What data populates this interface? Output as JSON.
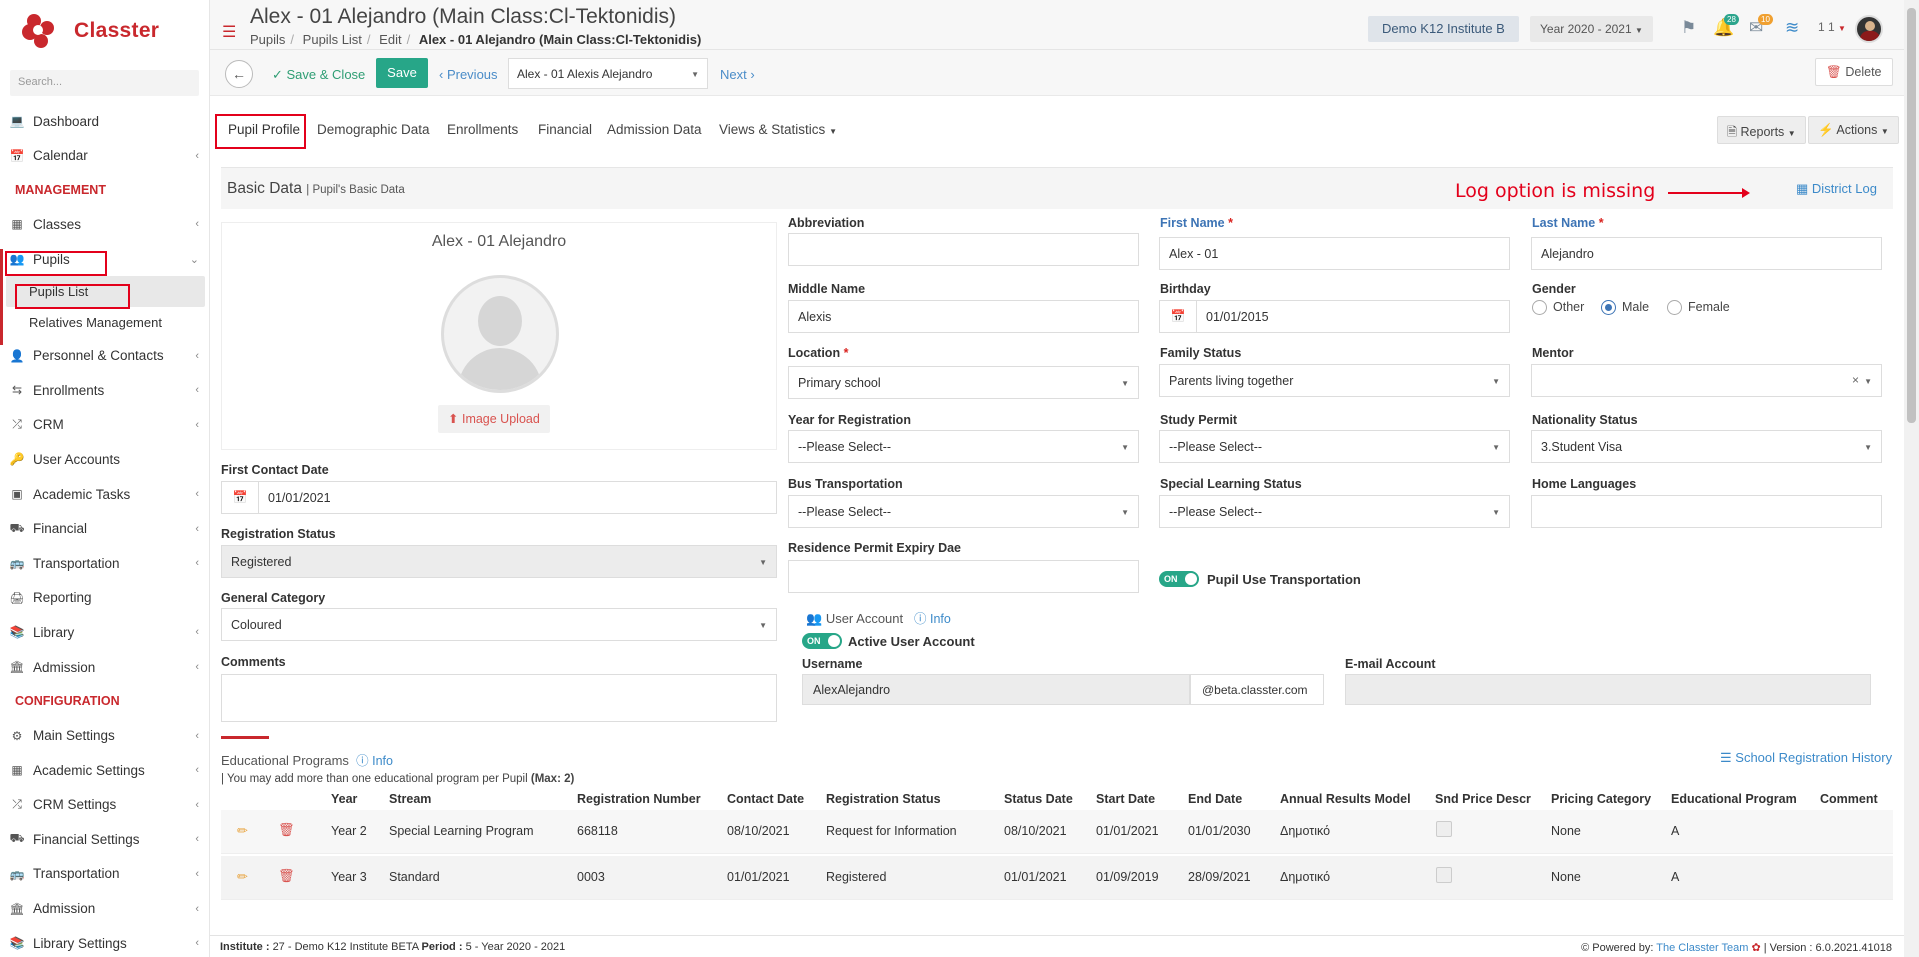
{
  "brand": {
    "name": "Classter"
  },
  "sidebar": {
    "search_placeholder": "Search...",
    "items_top": [
      {
        "label": "Dashboard",
        "icon": "laptop-icon"
      },
      {
        "label": "Calendar",
        "icon": "calendar-icon"
      }
    ],
    "section_management": "MANAGEMENT",
    "items_management": [
      {
        "label": "Classes",
        "icon": "classes-icon"
      },
      {
        "label": "Pupils",
        "icon": "users-icon"
      }
    ],
    "pupils_sub": [
      "Pupils List",
      "Relatives Management"
    ],
    "items_more": [
      {
        "label": "Personnel & Contacts",
        "icon": "person-icon"
      },
      {
        "label": "Enrollments",
        "icon": "exchange-icon"
      },
      {
        "label": "CRM",
        "icon": "random-icon"
      },
      {
        "label": "User Accounts",
        "icon": "key-icon"
      },
      {
        "label": "Academic Tasks",
        "icon": "grid-icon"
      },
      {
        "label": "Financial",
        "icon": "coins-icon"
      },
      {
        "label": "Transportation",
        "icon": "bus-icon"
      },
      {
        "label": "Reporting",
        "icon": "printer-icon"
      },
      {
        "label": "Library",
        "icon": "books-icon"
      },
      {
        "label": "Admission",
        "icon": "bank-icon"
      }
    ],
    "section_configuration": "CONFIGURATION",
    "items_config": [
      {
        "label": "Main Settings",
        "icon": "sliders-icon"
      },
      {
        "label": "Academic Settings",
        "icon": "classes-icon"
      },
      {
        "label": "CRM Settings",
        "icon": "random-icon"
      },
      {
        "label": "Financial Settings",
        "icon": "coins-icon"
      },
      {
        "label": "Transportation",
        "icon": "bus-icon"
      },
      {
        "label": "Admission",
        "icon": "bank-icon"
      },
      {
        "label": "Library Settings",
        "icon": "books-icon"
      }
    ]
  },
  "header": {
    "title": "Alex - 01 Alejandro (Main Class:Cl-Tektonidis)",
    "breadcrumb": [
      "Pupils",
      "Pupils List",
      "Edit",
      "Alex - 01 Alejandro (Main Class:Cl-Tektonidis)"
    ],
    "institute": "Demo K12 Institute B",
    "year": "Year 2020 - 2021",
    "notifications_count": "28",
    "messages_count": "10",
    "user_counter": "1 1"
  },
  "toolbar": {
    "save_close": "Save & Close",
    "save": "Save",
    "previous": "Previous",
    "pupil_select": "Alex - 01 Alexis Alejandro",
    "next": "Next",
    "delete": "Delete"
  },
  "tabs": [
    "Pupil Profile",
    "Demographic Data",
    "Enrollments",
    "Financial",
    "Admission Data",
    "Views & Statistics"
  ],
  "tab_buttons": {
    "reports": "Reports",
    "actions": "Actions"
  },
  "card": {
    "title": "Basic Data",
    "subtitle": "| Pupil's Basic Data",
    "annotation": "Log option is missing",
    "district_log": "District Log"
  },
  "photo": {
    "name": "Alex - 01 Alejandro",
    "upload": "Image Upload"
  },
  "form": {
    "abbreviation": {
      "label": "Abbreviation",
      "value": ""
    },
    "first_name": {
      "label": "First Name",
      "value": "Alex - 01"
    },
    "last_name": {
      "label": "Last Name",
      "value": "Alejandro"
    },
    "middle_name": {
      "label": "Middle Name",
      "value": "Alexis"
    },
    "birthday": {
      "label": "Birthday",
      "value": "01/01/2015"
    },
    "gender": {
      "label": "Gender",
      "options": [
        "Other",
        "Male",
        "Female"
      ],
      "selected": "Male"
    },
    "location": {
      "label": "Location",
      "value": "Primary school"
    },
    "family_status": {
      "label": "Family Status",
      "value": "Parents living together"
    },
    "mentor": {
      "label": "Mentor",
      "value": ""
    },
    "year_registration": {
      "label": "Year for Registration",
      "value": "--Please Select--"
    },
    "study_permit": {
      "label": "Study Permit",
      "value": "--Please Select--"
    },
    "nationality_status": {
      "label": "Nationality Status",
      "value": "3.Student Visa"
    },
    "bus_transportation": {
      "label": "Bus Transportation",
      "value": "--Please Select--"
    },
    "special_learning": {
      "label": "Special Learning Status",
      "value": "--Please Select--"
    },
    "home_languages": {
      "label": "Home Languages",
      "value": ""
    },
    "residence_permit": {
      "label": "Residence Permit Expiry Dae",
      "value": ""
    },
    "pupil_use_transport": {
      "label": "Pupil Use Transportation",
      "toggle": "ON"
    },
    "first_contact": {
      "label": "First Contact Date",
      "value": "01/01/2021"
    },
    "registration_status": {
      "label": "Registration Status",
      "value": "Registered"
    },
    "general_category": {
      "label": "General Category",
      "value": "Coloured"
    },
    "comments": {
      "label": "Comments",
      "value": ""
    }
  },
  "user_account": {
    "title": "User Account",
    "info": "Info",
    "active_label": "Active User Account",
    "toggle": "ON",
    "username_label": "Username",
    "username": "AlexAlejandro",
    "domain": "@beta.classter.com",
    "email_label": "E-mail Account",
    "email": ""
  },
  "edu_programs": {
    "title": "Educational Programs",
    "info": "Info",
    "note": "| You may add more than one educational program per Pupil",
    "max": "(Max: 2)",
    "history": "School Registration History",
    "columns": [
      "Year",
      "Stream",
      "Registration Number",
      "Contact Date",
      "Registration Status",
      "Status Date",
      "Start Date",
      "End Date",
      "Annual Results Model",
      "Snd Price Descr",
      "Pricing Category",
      "Educational Program",
      "Comment"
    ],
    "rows": [
      [
        "Year 2",
        "Special Learning Program",
        "668118",
        "08/10/2021",
        "Request for Information",
        "08/10/2021",
        "01/01/2021",
        "01/01/2030",
        "Δημοτικό",
        "",
        "None",
        "A",
        ""
      ],
      [
        "Year 3",
        "Standard",
        "0003",
        "01/01/2021",
        "Registered",
        "01/01/2021",
        "01/09/2019",
        "28/09/2021",
        "Δημοτικό",
        "",
        "None",
        "A",
        ""
      ]
    ]
  },
  "footer": {
    "institute_label": "Institute :",
    "institute": "27 - Demo K12 Institute BETA",
    "period_label": "Period :",
    "period": "5 - Year 2020 - 2021",
    "powered_by": "Powered by:",
    "team": "The Classter Team",
    "version_label": "| Version :",
    "version": "6.0.2021.41018"
  }
}
